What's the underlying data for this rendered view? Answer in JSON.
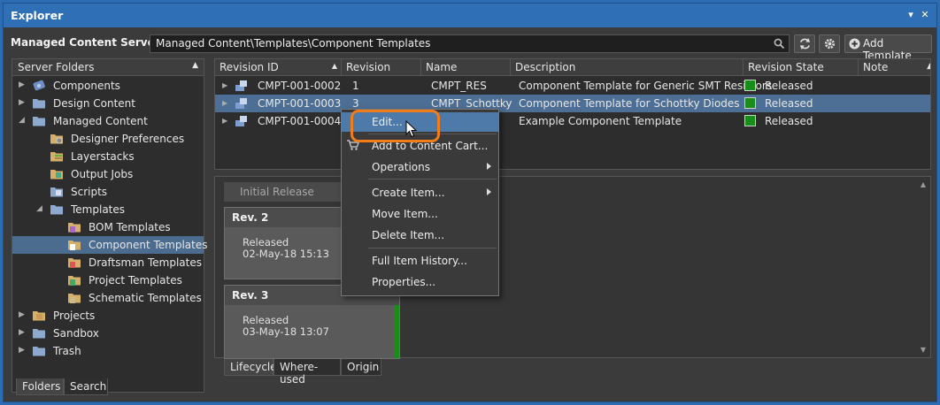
{
  "window": {
    "title": "Explorer"
  },
  "toolbar": {
    "server_label": "Managed Content Server",
    "path": "Managed Content\\Templates\\Component Templates",
    "add_template_label": "Add Template"
  },
  "folders_panel": {
    "header": "Server Folders",
    "items": [
      {
        "label": "Components"
      },
      {
        "label": "Design Content"
      },
      {
        "label": "Managed Content"
      },
      {
        "label": "Designer Preferences"
      },
      {
        "label": "Layerstacks"
      },
      {
        "label": "Output Jobs"
      },
      {
        "label": "Scripts"
      },
      {
        "label": "Templates"
      },
      {
        "label": "BOM Templates"
      },
      {
        "label": "Component Templates"
      },
      {
        "label": "Draftsman Templates"
      },
      {
        "label": "Project Templates"
      },
      {
        "label": "Schematic Templates"
      },
      {
        "label": "Projects"
      },
      {
        "label": "Sandbox"
      },
      {
        "label": "Trash"
      }
    ],
    "tabs": [
      "Folders",
      "Search"
    ]
  },
  "grid": {
    "columns": [
      "Revision ID",
      "Revision",
      "Name",
      "Description",
      "Revision State",
      "Note"
    ],
    "rows": [
      {
        "id": "CMPT-001-0002",
        "revision": "1",
        "name": "CMPT_RES",
        "description": "Component Template for Generic SMT Resistors",
        "state": "Released"
      },
      {
        "id": "CMPT-001-0003",
        "revision": "3",
        "name": "CMPT_Schottky",
        "description": "Component Template for Schottky Diodes",
        "state": "Released"
      },
      {
        "id": "CMPT-001-0004",
        "revision": "",
        "name": "",
        "description": "Example Component Template",
        "state": "Released"
      }
    ]
  },
  "context_menu": {
    "items": [
      "Edit...",
      "Add to Content Cart...",
      "Operations",
      "Create Item...",
      "Move Item...",
      "Delete Item...",
      "Full Item History...",
      "Properties..."
    ]
  },
  "lifecycle": {
    "initial_release": "Initial Release",
    "cards": [
      {
        "title": "Rev. 2",
        "status": "Released",
        "date": "02-May-18 15:13"
      },
      {
        "title": "Rev. 3",
        "status": "Released",
        "date": "03-May-18 13:07"
      }
    ],
    "tabs": [
      "Lifecycle",
      "Where-used",
      "Origin"
    ]
  },
  "colors": {
    "accent": "#2f6fb5",
    "released": "#1a8c1a",
    "highlight": "#f07d1a"
  }
}
